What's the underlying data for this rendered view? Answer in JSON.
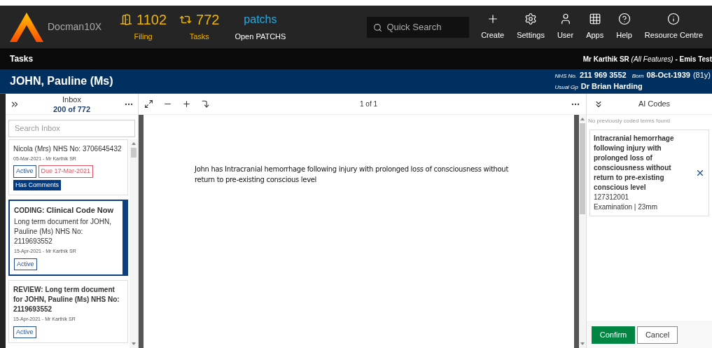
{
  "app": {
    "name": "Docman10X"
  },
  "counters": [
    {
      "kind": "filing",
      "count": "1102",
      "label": "Filing"
    },
    {
      "kind": "tasks",
      "count": "772",
      "label": "Tasks"
    }
  ],
  "patchs": {
    "logo": "patchs",
    "label": "Open PATCHS"
  },
  "search": {
    "placeholder": "Quick Search"
  },
  "nav": [
    {
      "kind": "create",
      "label": "Create"
    },
    {
      "kind": "settings",
      "label": "Settings"
    },
    {
      "kind": "user",
      "label": "User"
    },
    {
      "kind": "apps",
      "label": "Apps"
    },
    {
      "kind": "help",
      "label": "Help"
    },
    {
      "kind": "info",
      "label": "Resource Centre"
    }
  ],
  "section_bar": {
    "title": "Tasks",
    "user": "Mr Karthik SR",
    "role": "(All Features)",
    "org": "- Emis Test"
  },
  "patient": {
    "name": "JOHN, Pauline (Ms)",
    "nhs_label": "NHS No.",
    "nhs": "211 969 3552",
    "born_label": "Born",
    "born": "08-Oct-1939",
    "age": "(81y)",
    "gp_label": "Usual Gp",
    "gp": "Dr Brian Harding"
  },
  "inbox": {
    "title": "Inbox",
    "count": "200 of 772",
    "search_placeholder": "Search Inbox",
    "items": [
      {
        "body": "Nicola (Mrs) NHS No: 3706645432",
        "date": "05-Mar-2021 - Mr Karthik SR",
        "selected": false,
        "tags": [
          {
            "kind": "status",
            "label": "Active"
          },
          {
            "kind": "due",
            "label": "Due 17-Mar-2021"
          },
          {
            "kind": "comments",
            "label": "Has Comments"
          }
        ]
      },
      {
        "prefix": "CODING:",
        "title": "Clinical Code Now",
        "body": "Long term document for JOHN, Pauline (Ms) NHS No: 2119693552",
        "date": "15-Apr-2021 - Mr Karthik SR",
        "selected": true,
        "tags": [
          {
            "kind": "status",
            "label": "Active"
          }
        ]
      },
      {
        "prefix": "REVIEW:",
        "title": "Long term document for JOHN, Pauline (Ms) NHS No: 2119693552",
        "date": "15-Apr-2021 - Mr Karthik SR",
        "selected": false,
        "tags": [
          {
            "kind": "status",
            "label": "Active"
          }
        ]
      }
    ]
  },
  "viewer": {
    "page": "1 of 1",
    "text": "John has Intracranial hemorrhage following injury with prolonged loss of consciousness without return to pre-existing conscious level"
  },
  "ai_codes": {
    "title": "AI Codes",
    "notice": "No previously coded terms found",
    "codes": [
      {
        "term": "Intracranial hemorrhage following injury with prolonged loss of consciousness without return to pre-existing conscious level",
        "code": "127312001",
        "detail": "Examination | 23mm"
      }
    ],
    "confirm": "Confirm",
    "cancel": "Cancel"
  }
}
